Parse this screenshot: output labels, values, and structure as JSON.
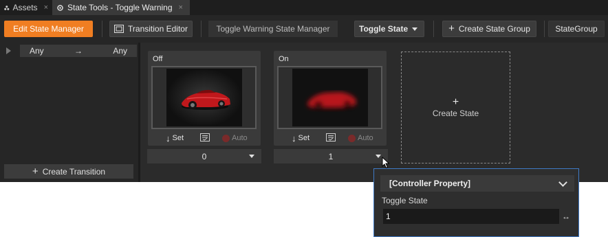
{
  "tabs": [
    {
      "label": "Assets",
      "close": "×",
      "icon": "assets-icon"
    },
    {
      "label": "State Tools - Toggle Warning",
      "close": "×",
      "icon": "state-tools-icon"
    }
  ],
  "toolbar": {
    "edit_state_manager": "Edit State Manager",
    "transition_editor": "Transition Editor",
    "state_manager_name": "Toggle Warning State Manager",
    "state_group_dropdown": "Toggle State",
    "create_state_group": "Create State Group",
    "state_group_name": "StateGroup"
  },
  "transitions": {
    "from": "Any",
    "arrow": "→",
    "to": "Any",
    "create_label": "Create Transition"
  },
  "states": [
    {
      "name": "Off",
      "set_label": "Set",
      "auto_label": "Auto",
      "value": "0",
      "image": "red-sports-car"
    },
    {
      "name": "On",
      "set_label": "Set",
      "auto_label": "Auto",
      "value": "1",
      "image": "red-sports-car-blurred"
    }
  ],
  "create_state_label": "Create State",
  "popup": {
    "header": "[Controller Property]",
    "field_label": "Toggle State",
    "field_value": "1",
    "bind_icon": "↔"
  },
  "colors": {
    "accent": "#f07e22",
    "focus_border": "#3f7ac6",
    "panel": "#2b2b2b"
  }
}
